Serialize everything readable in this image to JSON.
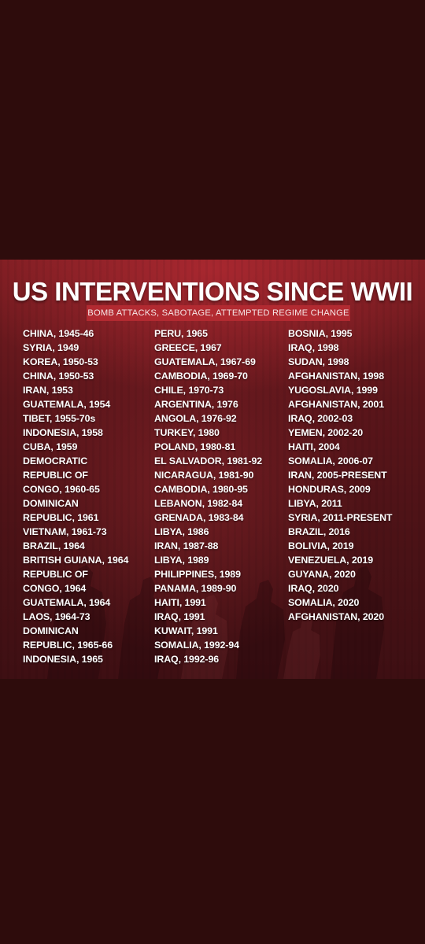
{
  "title": "US INTERVENTIONS SINCE WWII",
  "subtitle": "BOMB ATTACKS, SABOTAGE, ATTEMPTED REGIME CHANGE",
  "colors": {
    "page_background": "#2e0c0c",
    "poster_red": "#7c1d22",
    "subtitle_bar": "#b22a31",
    "text": "#ffffff"
  },
  "columns": [
    [
      "CHINA, 1945-46",
      "SYRIA, 1949",
      "KOREA, 1950-53",
      "CHINA, 1950-53",
      "IRAN, 1953",
      "GUATEMALA, 1954",
      "TIBET, 1955-70s",
      "INDONESIA, 1958",
      "CUBA, 1959",
      "DEMOCRATIC",
      "REPUBLIC OF",
      "CONGO, 1960-65",
      "DOMINICAN",
      "REPUBLIC, 1961",
      "VIETNAM, 1961-73",
      "BRAZIL, 1964",
      "BRITISH GUIANA, 1964",
      "REPUBLIC OF",
      "CONGO, 1964",
      "GUATEMALA, 1964",
      "LAOS, 1964-73",
      "DOMINICAN",
      "REPUBLIC, 1965-66",
      "INDONESIA, 1965"
    ],
    [
      "PERU, 1965",
      "GREECE, 1967",
      "GUATEMALA, 1967-69",
      "CAMBODIA, 1969-70",
      "CHILE, 1970-73",
      "ARGENTINA, 1976",
      "ANGOLA, 1976-92",
      "TURKEY, 1980",
      "POLAND, 1980-81",
      "EL SALVADOR, 1981-92",
      "NICARAGUA, 1981-90",
      "CAMBODIA, 1980-95",
      "LEBANON, 1982-84",
      "GRENADA, 1983-84",
      "LIBYA, 1986",
      "IRAN, 1987-88",
      "LIBYA, 1989",
      "PHILIPPINES, 1989",
      "PANAMA, 1989-90",
      "HAITI, 1991",
      "IRAQ, 1991",
      "KUWAIT, 1991",
      "SOMALIA, 1992-94",
      "IRAQ, 1992-96"
    ],
    [
      "BOSNIA, 1995",
      "IRAQ, 1998",
      "SUDAN, 1998",
      "AFGHANISTAN, 1998",
      "YUGOSLAVIA, 1999",
      "AFGHANISTAN, 2001",
      "IRAQ, 2002-03",
      "YEMEN, 2002-20",
      "HAITI, 2004",
      "SOMALIA, 2006-07",
      "IRAN, 2005-PRESENT",
      "HONDURAS, 2009",
      "LIBYA, 2011",
      "SYRIA, 2011-PRESENT",
      "BRAZIL, 2016",
      "BOLIVIA, 2019",
      "VENEZUELA, 2019",
      "GUYANA, 2020",
      "IRAQ, 2020",
      "SOMALIA, 2020",
      "AFGHANISTAN, 2020"
    ]
  ]
}
